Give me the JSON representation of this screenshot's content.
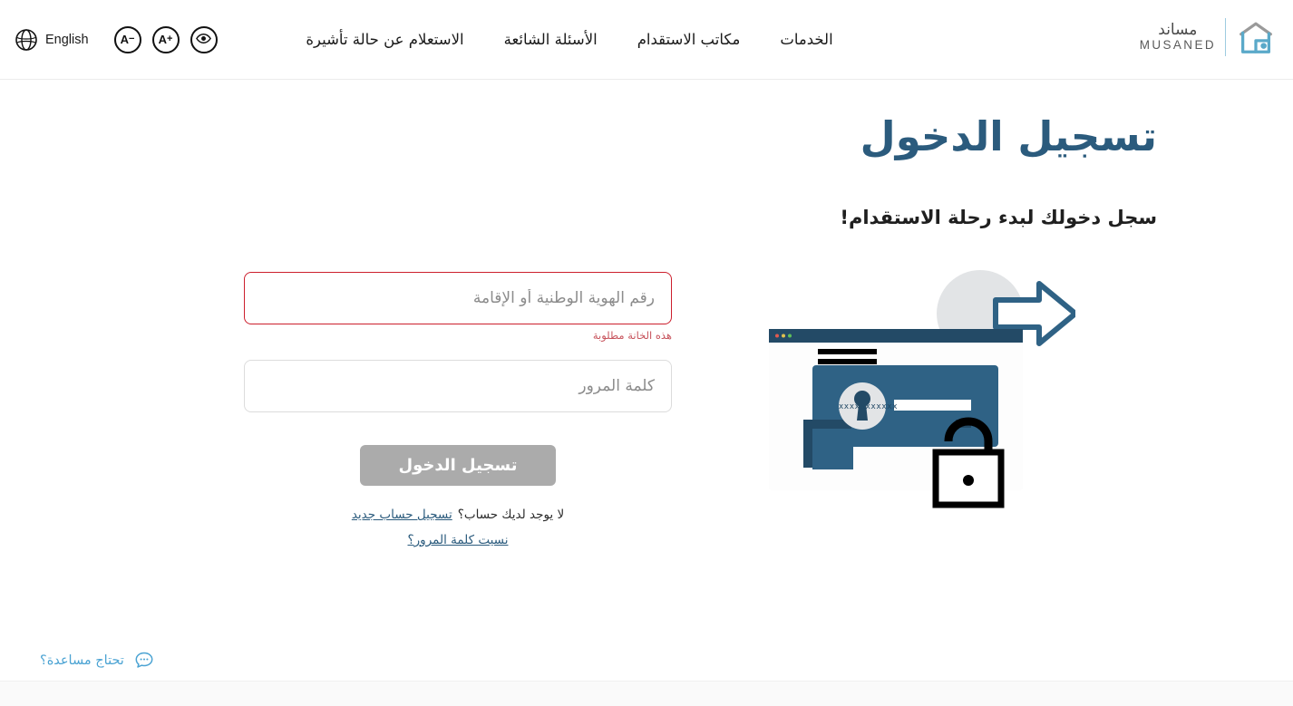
{
  "header": {
    "language_label": "English",
    "globe_icon": "globe-icon",
    "a11y": [
      {
        "id": "decrease-font",
        "letter": "A",
        "sign": "−",
        "name": "font-decrease-button"
      },
      {
        "id": "increase-font",
        "letter": "A",
        "sign": "+",
        "name": "font-increase-button"
      }
    ],
    "eye_icon": "eye-icon",
    "nav_items": [
      {
        "label": "الخدمات",
        "name": "nav-item-services"
      },
      {
        "label": "مكاتب الاستقدام",
        "name": "nav-item-recruitment-offices"
      },
      {
        "label": "الأسئلة الشائعة",
        "name": "nav-item-faq"
      },
      {
        "label": "الاستعلام عن حالة تأشيرة",
        "name": "nav-item-visa-status"
      }
    ],
    "logo": {
      "arabic": "مساند",
      "english": "MUSANED",
      "mark_icon": "house-logo-icon"
    }
  },
  "main": {
    "title": "تسجيل الدخول",
    "subtitle": "سجل دخولك لبدء رحلة الاستقدام!",
    "illustration_name": "login-security-illustration"
  },
  "form": {
    "national_id": {
      "placeholder": "رقم الهوية الوطنية أو الإقامة",
      "value": "",
      "error": "هذه الخانة مطلوبة"
    },
    "password": {
      "placeholder": "كلمة المرور",
      "value": ""
    },
    "submit_label": "تسجيل الدخول",
    "no_account_text": "لا يوجد لديك حساب؟",
    "register_link": "تسجيل حساب جديد",
    "forgot_password_link": "نسيت كلمة المرور؟"
  },
  "help": {
    "label": "تحتاج مساعدة؟",
    "icon": "chat-bubble-icon"
  },
  "colors": {
    "brand_blue": "#2b5b7d",
    "accent_light_blue": "#4ba3d3",
    "error_red": "#cc1f2d",
    "error_text": "#c7535c",
    "disabled_gray": "#ababab",
    "illustration_blue": "#2f6285",
    "illustration_dark": "#234a66"
  }
}
